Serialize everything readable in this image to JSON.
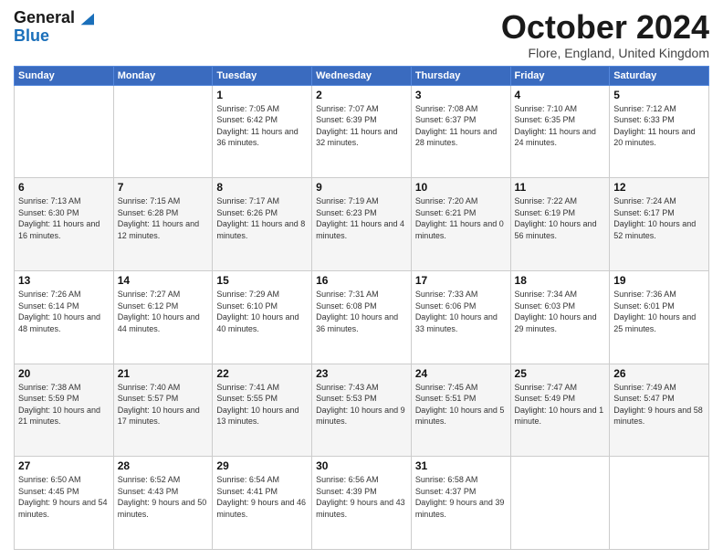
{
  "header": {
    "logo_general": "General",
    "logo_blue": "Blue",
    "month": "October 2024",
    "location": "Flore, England, United Kingdom"
  },
  "days_of_week": [
    "Sunday",
    "Monday",
    "Tuesday",
    "Wednesday",
    "Thursday",
    "Friday",
    "Saturday"
  ],
  "weeks": [
    [
      {
        "day": "",
        "info": ""
      },
      {
        "day": "",
        "info": ""
      },
      {
        "day": "1",
        "info": "Sunrise: 7:05 AM\nSunset: 6:42 PM\nDaylight: 11 hours\nand 36 minutes."
      },
      {
        "day": "2",
        "info": "Sunrise: 7:07 AM\nSunset: 6:39 PM\nDaylight: 11 hours\nand 32 minutes."
      },
      {
        "day": "3",
        "info": "Sunrise: 7:08 AM\nSunset: 6:37 PM\nDaylight: 11 hours\nand 28 minutes."
      },
      {
        "day": "4",
        "info": "Sunrise: 7:10 AM\nSunset: 6:35 PM\nDaylight: 11 hours\nand 24 minutes."
      },
      {
        "day": "5",
        "info": "Sunrise: 7:12 AM\nSunset: 6:33 PM\nDaylight: 11 hours\nand 20 minutes."
      }
    ],
    [
      {
        "day": "6",
        "info": "Sunrise: 7:13 AM\nSunset: 6:30 PM\nDaylight: 11 hours\nand 16 minutes."
      },
      {
        "day": "7",
        "info": "Sunrise: 7:15 AM\nSunset: 6:28 PM\nDaylight: 11 hours\nand 12 minutes."
      },
      {
        "day": "8",
        "info": "Sunrise: 7:17 AM\nSunset: 6:26 PM\nDaylight: 11 hours\nand 8 minutes."
      },
      {
        "day": "9",
        "info": "Sunrise: 7:19 AM\nSunset: 6:23 PM\nDaylight: 11 hours\nand 4 minutes."
      },
      {
        "day": "10",
        "info": "Sunrise: 7:20 AM\nSunset: 6:21 PM\nDaylight: 11 hours\nand 0 minutes."
      },
      {
        "day": "11",
        "info": "Sunrise: 7:22 AM\nSunset: 6:19 PM\nDaylight: 10 hours\nand 56 minutes."
      },
      {
        "day": "12",
        "info": "Sunrise: 7:24 AM\nSunset: 6:17 PM\nDaylight: 10 hours\nand 52 minutes."
      }
    ],
    [
      {
        "day": "13",
        "info": "Sunrise: 7:26 AM\nSunset: 6:14 PM\nDaylight: 10 hours\nand 48 minutes."
      },
      {
        "day": "14",
        "info": "Sunrise: 7:27 AM\nSunset: 6:12 PM\nDaylight: 10 hours\nand 44 minutes."
      },
      {
        "day": "15",
        "info": "Sunrise: 7:29 AM\nSunset: 6:10 PM\nDaylight: 10 hours\nand 40 minutes."
      },
      {
        "day": "16",
        "info": "Sunrise: 7:31 AM\nSunset: 6:08 PM\nDaylight: 10 hours\nand 36 minutes."
      },
      {
        "day": "17",
        "info": "Sunrise: 7:33 AM\nSunset: 6:06 PM\nDaylight: 10 hours\nand 33 minutes."
      },
      {
        "day": "18",
        "info": "Sunrise: 7:34 AM\nSunset: 6:03 PM\nDaylight: 10 hours\nand 29 minutes."
      },
      {
        "day": "19",
        "info": "Sunrise: 7:36 AM\nSunset: 6:01 PM\nDaylight: 10 hours\nand 25 minutes."
      }
    ],
    [
      {
        "day": "20",
        "info": "Sunrise: 7:38 AM\nSunset: 5:59 PM\nDaylight: 10 hours\nand 21 minutes."
      },
      {
        "day": "21",
        "info": "Sunrise: 7:40 AM\nSunset: 5:57 PM\nDaylight: 10 hours\nand 17 minutes."
      },
      {
        "day": "22",
        "info": "Sunrise: 7:41 AM\nSunset: 5:55 PM\nDaylight: 10 hours\nand 13 minutes."
      },
      {
        "day": "23",
        "info": "Sunrise: 7:43 AM\nSunset: 5:53 PM\nDaylight: 10 hours\nand 9 minutes."
      },
      {
        "day": "24",
        "info": "Sunrise: 7:45 AM\nSunset: 5:51 PM\nDaylight: 10 hours\nand 5 minutes."
      },
      {
        "day": "25",
        "info": "Sunrise: 7:47 AM\nSunset: 5:49 PM\nDaylight: 10 hours\nand 1 minute."
      },
      {
        "day": "26",
        "info": "Sunrise: 7:49 AM\nSunset: 5:47 PM\nDaylight: 9 hours\nand 58 minutes."
      }
    ],
    [
      {
        "day": "27",
        "info": "Sunrise: 6:50 AM\nSunset: 4:45 PM\nDaylight: 9 hours\nand 54 minutes."
      },
      {
        "day": "28",
        "info": "Sunrise: 6:52 AM\nSunset: 4:43 PM\nDaylight: 9 hours\nand 50 minutes."
      },
      {
        "day": "29",
        "info": "Sunrise: 6:54 AM\nSunset: 4:41 PM\nDaylight: 9 hours\nand 46 minutes."
      },
      {
        "day": "30",
        "info": "Sunrise: 6:56 AM\nSunset: 4:39 PM\nDaylight: 9 hours\nand 43 minutes."
      },
      {
        "day": "31",
        "info": "Sunrise: 6:58 AM\nSunset: 4:37 PM\nDaylight: 9 hours\nand 39 minutes."
      },
      {
        "day": "",
        "info": ""
      },
      {
        "day": "",
        "info": ""
      }
    ]
  ]
}
